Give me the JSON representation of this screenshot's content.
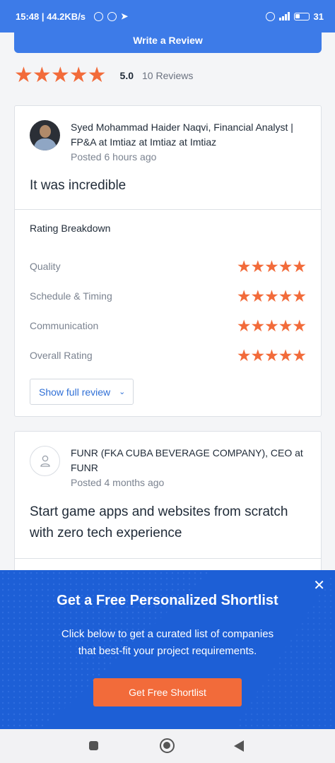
{
  "status_bar": {
    "time_speed": "15:48 | 44.2KB/s",
    "battery": "31"
  },
  "write_review_button": "Write a Review",
  "summary": {
    "score": "5.0",
    "count": "10 Reviews",
    "stars": 5
  },
  "reviews": [
    {
      "reviewer": "Syed Mohammad Haider Naqvi, Financial Analyst | FP&A at Imtiaz at Imtiaz at Imtiaz",
      "posted": "Posted 6 hours ago",
      "title": "It was incredible",
      "breakdown_title": "Rating Breakdown",
      "breakdown": [
        {
          "label": "Quality",
          "stars": 5
        },
        {
          "label": "Schedule & Timing",
          "stars": 5
        },
        {
          "label": "Communication",
          "stars": 5
        },
        {
          "label": "Overall Rating",
          "stars": 5
        }
      ],
      "show_full_label": "Show full review"
    },
    {
      "reviewer": "FUNR (FKA CUBA BEVERAGE COMPANY), CEO at FUNR",
      "posted": "Posted 4 months ago",
      "title": "Start game apps and websites from scratch with zero tech experience"
    }
  ],
  "banner": {
    "title": "Get a Free Personalized Shortlist",
    "text_line1": "Click below to get a curated list of companies",
    "text_line2": "that best-fit your project requirements.",
    "button_label": "Get Free Shortlist"
  },
  "colors": {
    "brand_blue": "#3d7be8",
    "star_orange": "#f26b3a",
    "banner_blue": "#1d5fd6"
  }
}
